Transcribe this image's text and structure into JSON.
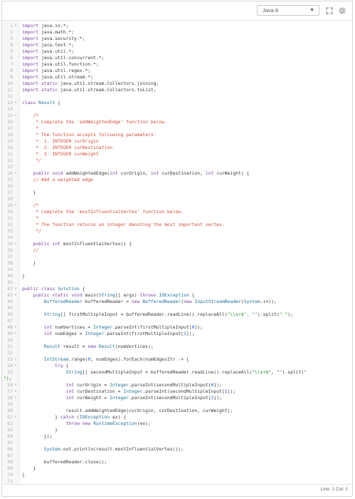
{
  "toolbar": {
    "language": "Java 8",
    "icons": [
      "expand-icon",
      "settings-icon"
    ]
  },
  "status": {
    "cursor": "Line: 1 Col: 1"
  },
  "code": [
    {
      "n": "1",
      "f": true,
      "t": "import java.io.*;"
    },
    {
      "n": "2",
      "t": "import java.math.*;"
    },
    {
      "n": "3",
      "t": "import java.security.*;"
    },
    {
      "n": "4",
      "t": "import java.text.*;"
    },
    {
      "n": "5",
      "t": "import java.util.*;"
    },
    {
      "n": "6",
      "t": "import java.util.concurrent.*;"
    },
    {
      "n": "7",
      "t": "import java.util.function.*;"
    },
    {
      "n": "8",
      "t": "import java.util.regex.*;"
    },
    {
      "n": "9",
      "t": "import java.util.stream.*;"
    },
    {
      "n": "10",
      "t": "import static java.util.stream.Collectors.joining;"
    },
    {
      "n": "11",
      "t": "import static java.util.stream.Collectors.toList;"
    },
    {
      "n": "12",
      "t": ""
    },
    {
      "n": "13",
      "f": true,
      "t": "class Result {"
    },
    {
      "n": "14",
      "t": ""
    },
    {
      "n": "15",
      "f": true,
      "t": "    /*"
    },
    {
      "n": "16",
      "t": "     * Complete the 'addWeightedEdge' function below."
    },
    {
      "n": "17",
      "t": "     *"
    },
    {
      "n": "18",
      "t": "     * The function accepts following parameters:"
    },
    {
      "n": "19",
      "t": "     *  1. INTEGER curOrigin"
    },
    {
      "n": "20",
      "t": "     *  2. INTEGER curDestination"
    },
    {
      "n": "21",
      "t": "     *  3. INTEGER curWeight"
    },
    {
      "n": "22",
      "t": "     */"
    },
    {
      "n": "23",
      "t": ""
    },
    {
      "n": "24",
      "f": true,
      "t": "    public void addWeightedEdge(int curOrigin, int curDestination, int curWeight) {"
    },
    {
      "n": "25",
      "t": "    // Add a weighted edge"
    },
    {
      "n": "26",
      "t": ""
    },
    {
      "n": "27",
      "t": "    }"
    },
    {
      "n": "28",
      "t": ""
    },
    {
      "n": "29",
      "f": true,
      "t": "    /*"
    },
    {
      "n": "30",
      "t": "     * Complete the 'mostInfluentialVertex' function below."
    },
    {
      "n": "31",
      "t": "     *"
    },
    {
      "n": "32",
      "t": "     * The function returns an integer denoting the most important vertex."
    },
    {
      "n": "33",
      "t": "     */"
    },
    {
      "n": "34",
      "t": ""
    },
    {
      "n": "35",
      "f": true,
      "t": "    public int mostInfluentialVertex() {"
    },
    {
      "n": "36",
      "t": "    //"
    },
    {
      "n": "37",
      "t": ""
    },
    {
      "n": "38",
      "t": "    }"
    },
    {
      "n": "39",
      "t": ""
    },
    {
      "n": "40",
      "t": "}"
    },
    {
      "n": "41",
      "t": ""
    },
    {
      "n": "42",
      "f": true,
      "t": "public class Solution {"
    },
    {
      "n": "43",
      "f": true,
      "t": "    public static void main(String[] args) throws IOException {"
    },
    {
      "n": "44",
      "t": "        BufferedReader bufferedReader = new BufferedReader(new InputStreamReader(System.in));"
    },
    {
      "n": "45",
      "t": ""
    },
    {
      "n": "46",
      "t": "        String[] firstMultipleInput = bufferedReader.readLine().replaceAll(\"\\\\s+$\", \"\").split(\" \");"
    },
    {
      "n": "47",
      "t": ""
    },
    {
      "n": "48",
      "f": true,
      "t": "        int numVertices = Integer.parseInt(firstMultipleInput[0]);"
    },
    {
      "n": "49",
      "f": true,
      "t": "        int numEdges = Integer.parseInt(firstMultipleInput[1]);"
    },
    {
      "n": "50",
      "t": ""
    },
    {
      "n": "51",
      "t": "        Result result = new Result(numVertices);"
    },
    {
      "n": "52",
      "t": ""
    },
    {
      "n": "53",
      "f": true,
      "t": "        IntStream.range(0, numEdges).forEach(numEdgesItr -> {"
    },
    {
      "n": "54",
      "f": true,
      "t": "            try {"
    },
    {
      "n": "55",
      "t": "                String[] secondMultipleInput = bufferedReader.readLine().replaceAll(\"\\\\s+$\", \"\").split(\""
    },
    {
      "n": "",
      "t": "\");"
    },
    {
      "n": "56",
      "f": true,
      "t": "                int curOrigin = Integer.parseInt(secondMultipleInput[0]);"
    },
    {
      "n": "57",
      "f": true,
      "t": "                int curDestination = Integer.parseInt(secondMultipleInput[1]);"
    },
    {
      "n": "58",
      "f": true,
      "t": "                int curWeight = Integer.parseInt(secondMultipleInput[2]);"
    },
    {
      "n": "59",
      "t": ""
    },
    {
      "n": "60",
      "t": "                result.addWeightedEdge(curOrigin, curDestination, curWeight);"
    },
    {
      "n": "61",
      "f": true,
      "t": "            } catch (IOException ex) {"
    },
    {
      "n": "62",
      "t": "                throw new RuntimeException(ex);"
    },
    {
      "n": "63",
      "t": "            }"
    },
    {
      "n": "64",
      "t": "        });"
    },
    {
      "n": "65",
      "t": ""
    },
    {
      "n": "66",
      "t": "        System.out.println(result.mostInfluentialVertex());"
    },
    {
      "n": "67",
      "t": ""
    },
    {
      "n": "68",
      "t": "        bufferedReader.close();"
    },
    {
      "n": "69",
      "t": "    }"
    },
    {
      "n": "70",
      "t": "}"
    },
    {
      "n": "71",
      "t": ""
    }
  ]
}
